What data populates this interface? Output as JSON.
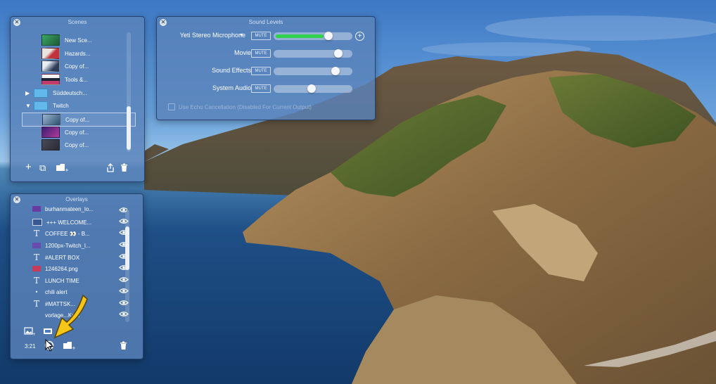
{
  "scenes": {
    "title": "Scenes",
    "items": [
      {
        "label": "New Sce...",
        "type": "scene",
        "thumb": "#2f8f56"
      },
      {
        "label": "Hazards...",
        "type": "scene",
        "thumb": "#b7343b"
      },
      {
        "label": "Copy of...",
        "type": "scene",
        "thumb": "#2b3b58"
      },
      {
        "label": "Tools &...",
        "type": "scene",
        "thumb": "#1e2436"
      },
      {
        "label": "Süddeutsch...",
        "type": "folder",
        "expanded": false
      },
      {
        "label": "Twitch",
        "type": "folder",
        "expanded": true
      },
      {
        "label": "Copy of...",
        "type": "scene",
        "thumb": "#2d4f6e",
        "selected": true
      },
      {
        "label": "Copy of...",
        "type": "scene",
        "thumb": "#5a2f8a"
      },
      {
        "label": "Copy of...",
        "type": "scene",
        "thumb": "#3b3a48"
      }
    ],
    "toolbar": {
      "add": "+",
      "duplicate": "⧉",
      "folder": "📁",
      "share": "⇪",
      "trash": "🗑"
    }
  },
  "sound": {
    "title": "Sound Levels",
    "rows": [
      {
        "label": "Yeti Stereo Microphone",
        "dropdown": "▾",
        "mute": "MUTE",
        "level": 0.72,
        "active_fill": 0.62
      },
      {
        "label": "Movie",
        "mute": "MUTE",
        "level": 0.85
      },
      {
        "label": "Sound Effects",
        "mute": "MUTE",
        "level": 0.8
      },
      {
        "label": "System Audio",
        "mute": "MUTE",
        "level": 0.5
      }
    ],
    "add_button": "+",
    "echo_label": "Use Echo Cancellation (Disabled For Current Output)",
    "accent": "#2fd24a"
  },
  "overlays": {
    "title": "Overlays",
    "items": [
      {
        "label": "burhanmateen_lo...",
        "icon": "image",
        "color": "#6b3aa0"
      },
      {
        "label": "+++ WELCOME...",
        "icon": "image",
        "color": "#3a5890"
      },
      {
        "label": "COFFEE 👀 - B...",
        "icon": "text"
      },
      {
        "label": "1200px-Twitch_l...",
        "icon": "image",
        "color": "#6a4bb0"
      },
      {
        "label": "#ALERT BOX",
        "icon": "text"
      },
      {
        "label": "1246264.png",
        "icon": "image",
        "color": "#c73b5b"
      },
      {
        "label": "LUNCH TIME",
        "icon": "text"
      },
      {
        "label": "chili alert",
        "icon": "dot"
      },
      {
        "label": "#MATTSK...",
        "icon": "text"
      },
      {
        "label": "vorlage...Ko...",
        "icon": "none"
      }
    ],
    "toolbar": {
      "time": "3:21",
      "text_char": "T",
      "trash": "🗑"
    }
  }
}
